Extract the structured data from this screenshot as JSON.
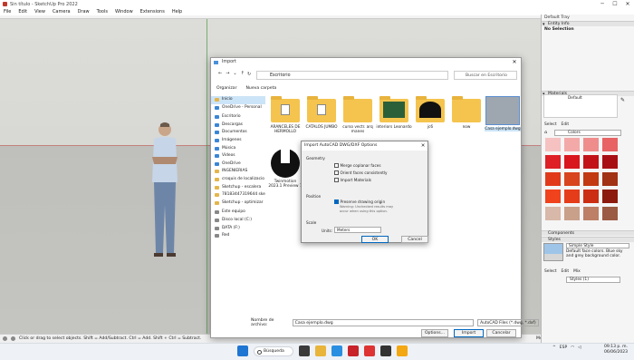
{
  "app": {
    "title": "Sin título - SketchUp Pro 2022"
  },
  "menu": [
    "File",
    "Edit",
    "View",
    "Camera",
    "Draw",
    "Tools",
    "Window",
    "Extensions",
    "Help"
  ],
  "status": {
    "text": "Click or drag to select objects. Shift = Add/Subtract. Ctrl = Add. Shift + Ctrl = Subtract.",
    "measurements": "Measurements"
  },
  "tray": {
    "title": "Default Tray",
    "entity_info": "Entity Info",
    "no_selection": "No Selection",
    "materials": "Materials",
    "default_label": "Default",
    "select_tab": "Select",
    "edit_tab": "Edit",
    "colors_select": "Colors",
    "components": "Components",
    "styles": "Styles",
    "style_name": "Simple Style",
    "style_desc": "Default face colors. Blue sky and grey background color.",
    "styles_select_tab": "Select",
    "styles_edit_tab": "Edit",
    "styles_mix_tab": "Mix",
    "styles_dropdown": "Styles (1)",
    "swatch_colors": [
      "#f6c1c1",
      "#f4a9a9",
      "#ef8d8d",
      "#e86363",
      "#de1f26",
      "#d9151d",
      "#c21218",
      "#a80f14",
      "#e13a1a",
      "#d8441d",
      "#c23a12",
      "#a13214",
      "#f0421d",
      "#e53c1a",
      "#cc2e13",
      "#8c1a0e",
      "#d8b8a8",
      "#c9a08a",
      "#bd7f66",
      "#9b5a43"
    ]
  },
  "import": {
    "title": "Import",
    "path": "Escritorio",
    "search": "Buscar en Escritorio",
    "organize": "Organizar",
    "new_folder": "Nueva carpeta",
    "nav": [
      {
        "label": "Inicio",
        "kind": "home"
      },
      {
        "label": "OneDrive - Personal",
        "kind": "blue"
      },
      {
        "label": "Escritorio",
        "kind": "blue"
      },
      {
        "label": "Descargas",
        "kind": "blue"
      },
      {
        "label": "Documentos",
        "kind": "blue"
      },
      {
        "label": "Imágenes",
        "kind": "blue"
      },
      {
        "label": "Música",
        "kind": "blue"
      },
      {
        "label": "Videos",
        "kind": "blue"
      },
      {
        "label": "OneDrive",
        "kind": "blue"
      },
      {
        "label": "INGENIERIAS",
        "kind": "folder"
      },
      {
        "label": "croquis de localizacio",
        "kind": "folder"
      },
      {
        "label": "Sketchup - escalera",
        "kind": "folder"
      },
      {
        "label": "78183447319644 sketc",
        "kind": "folder"
      },
      {
        "label": "Sketchup - optimizar",
        "kind": "folder"
      },
      {
        "label": "Este equipo",
        "kind": "drive"
      },
      {
        "label": "Disco local (C:)",
        "kind": "drive"
      },
      {
        "label": "DATA (F:)",
        "kind": "drive"
      },
      {
        "label": "Red",
        "kind": "drive"
      }
    ],
    "files": [
      {
        "label": "ARANCELES DE HERMOLLO",
        "kind": "doc"
      },
      {
        "label": "CATALOS JUMBO",
        "kind": "doc"
      },
      {
        "label": "curso vectr. arq manes",
        "kind": "folder"
      },
      {
        "label": "interiors Leonardo",
        "kind": "img"
      },
      {
        "label": "jc6",
        "kind": "img2"
      },
      {
        "label": "now",
        "kind": "folder"
      },
      {
        "label": "Casa ejemplo.dwg",
        "kind": "dwg"
      },
      {
        "label": "Twinmotion 2023.1 Preview 1",
        "kind": "tm"
      }
    ],
    "filename_label": "Nombre de archivo:",
    "filename": "Casa ejemplo.dwg",
    "filetype": "AutoCAD Files (*.dwg, *.dxf)",
    "options": "Options...",
    "import_btn": "Import",
    "cancel": "Cancelar"
  },
  "options": {
    "title": "Import AutoCAD DWG/DXF Options",
    "geometry": "Geometry",
    "merge": "Merge coplanar faces",
    "orient": "Orient faces consistently",
    "import_materials": "Import Materials",
    "position": "Position",
    "preserve": "Preserve drawing origin",
    "warning": "Warning: Unchecked results may occur when using this option.",
    "scale": "Scale",
    "units_label": "Units:",
    "units": "Meters",
    "ok": "OK",
    "cancel": "Cancel"
  },
  "taskbar": {
    "search": "Búsqueda",
    "lang": "ESP",
    "time": "09:13 p. m.",
    "date": "06/06/2023"
  }
}
